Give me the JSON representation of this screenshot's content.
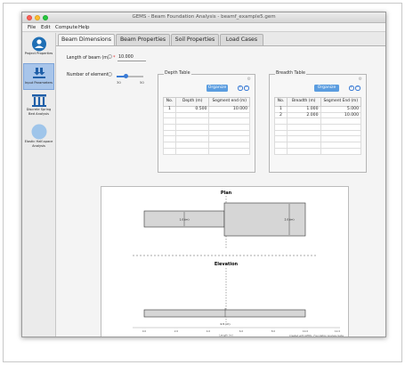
{
  "window": {
    "title": "GEMS - Beam Foundation Analysis - beamf_example5.gem"
  },
  "menu": [
    "File",
    "Edit",
    "Compute",
    "Help"
  ],
  "sidebar": {
    "items": [
      {
        "label": "Project Properties",
        "icon": "project-icon",
        "active": false
      },
      {
        "label": "Input Parameters",
        "icon": "input-icon",
        "active": true
      },
      {
        "label": "Discrete Spring Bed Analysis",
        "icon": "spring-bed-icon",
        "active": false
      },
      {
        "label": "Elastic Half-space Analysis",
        "icon": "half-space-icon",
        "active": false
      }
    ]
  },
  "tabs": [
    {
      "label": "Beam Dimensions",
      "active": true
    },
    {
      "label": "Beam Properties",
      "active": false
    },
    {
      "label": "Soil Properties",
      "active": false
    },
    {
      "label": "Load Cases",
      "active": false
    }
  ],
  "form": {
    "length_label": "Length of beam (m)",
    "length_value": "10.000",
    "elements_label": "Number of elements",
    "elements_min": "30",
    "elements_max": "50",
    "elements_fraction": 0.35
  },
  "depth_table": {
    "title": "Depth Table",
    "organize_label": "Organize",
    "columns": [
      "No.",
      "Depth (m)",
      "Segment end (m)"
    ],
    "rows": [
      [
        "1",
        "0.500",
        "10.000"
      ]
    ],
    "empty_rows": 7
  },
  "breadth_table": {
    "title": "Breadth Table",
    "organize_label": "Organize",
    "columns": [
      "No.",
      "Breadth (m)",
      "Segment End (m)"
    ],
    "rows": [
      [
        "1",
        "1.000",
        "5.000"
      ],
      [
        "2",
        "2.000",
        "10.000"
      ]
    ],
    "empty_rows": 6
  },
  "plot": {
    "plan_title": "Plan",
    "plan_dim_left": "1.0 (m)",
    "plan_dim_right": "2.0 (m)",
    "elevation_title": "Elevation",
    "elevation_dim": "0.5 (m)",
    "xlabel": "Length (m)",
    "ticks": [
      "0.0",
      "2.0",
      "4.0",
      "6.0",
      "8.0",
      "10.0",
      "12.0"
    ],
    "credit": "Created with GEMS - Foundation Analysis Suite"
  }
}
